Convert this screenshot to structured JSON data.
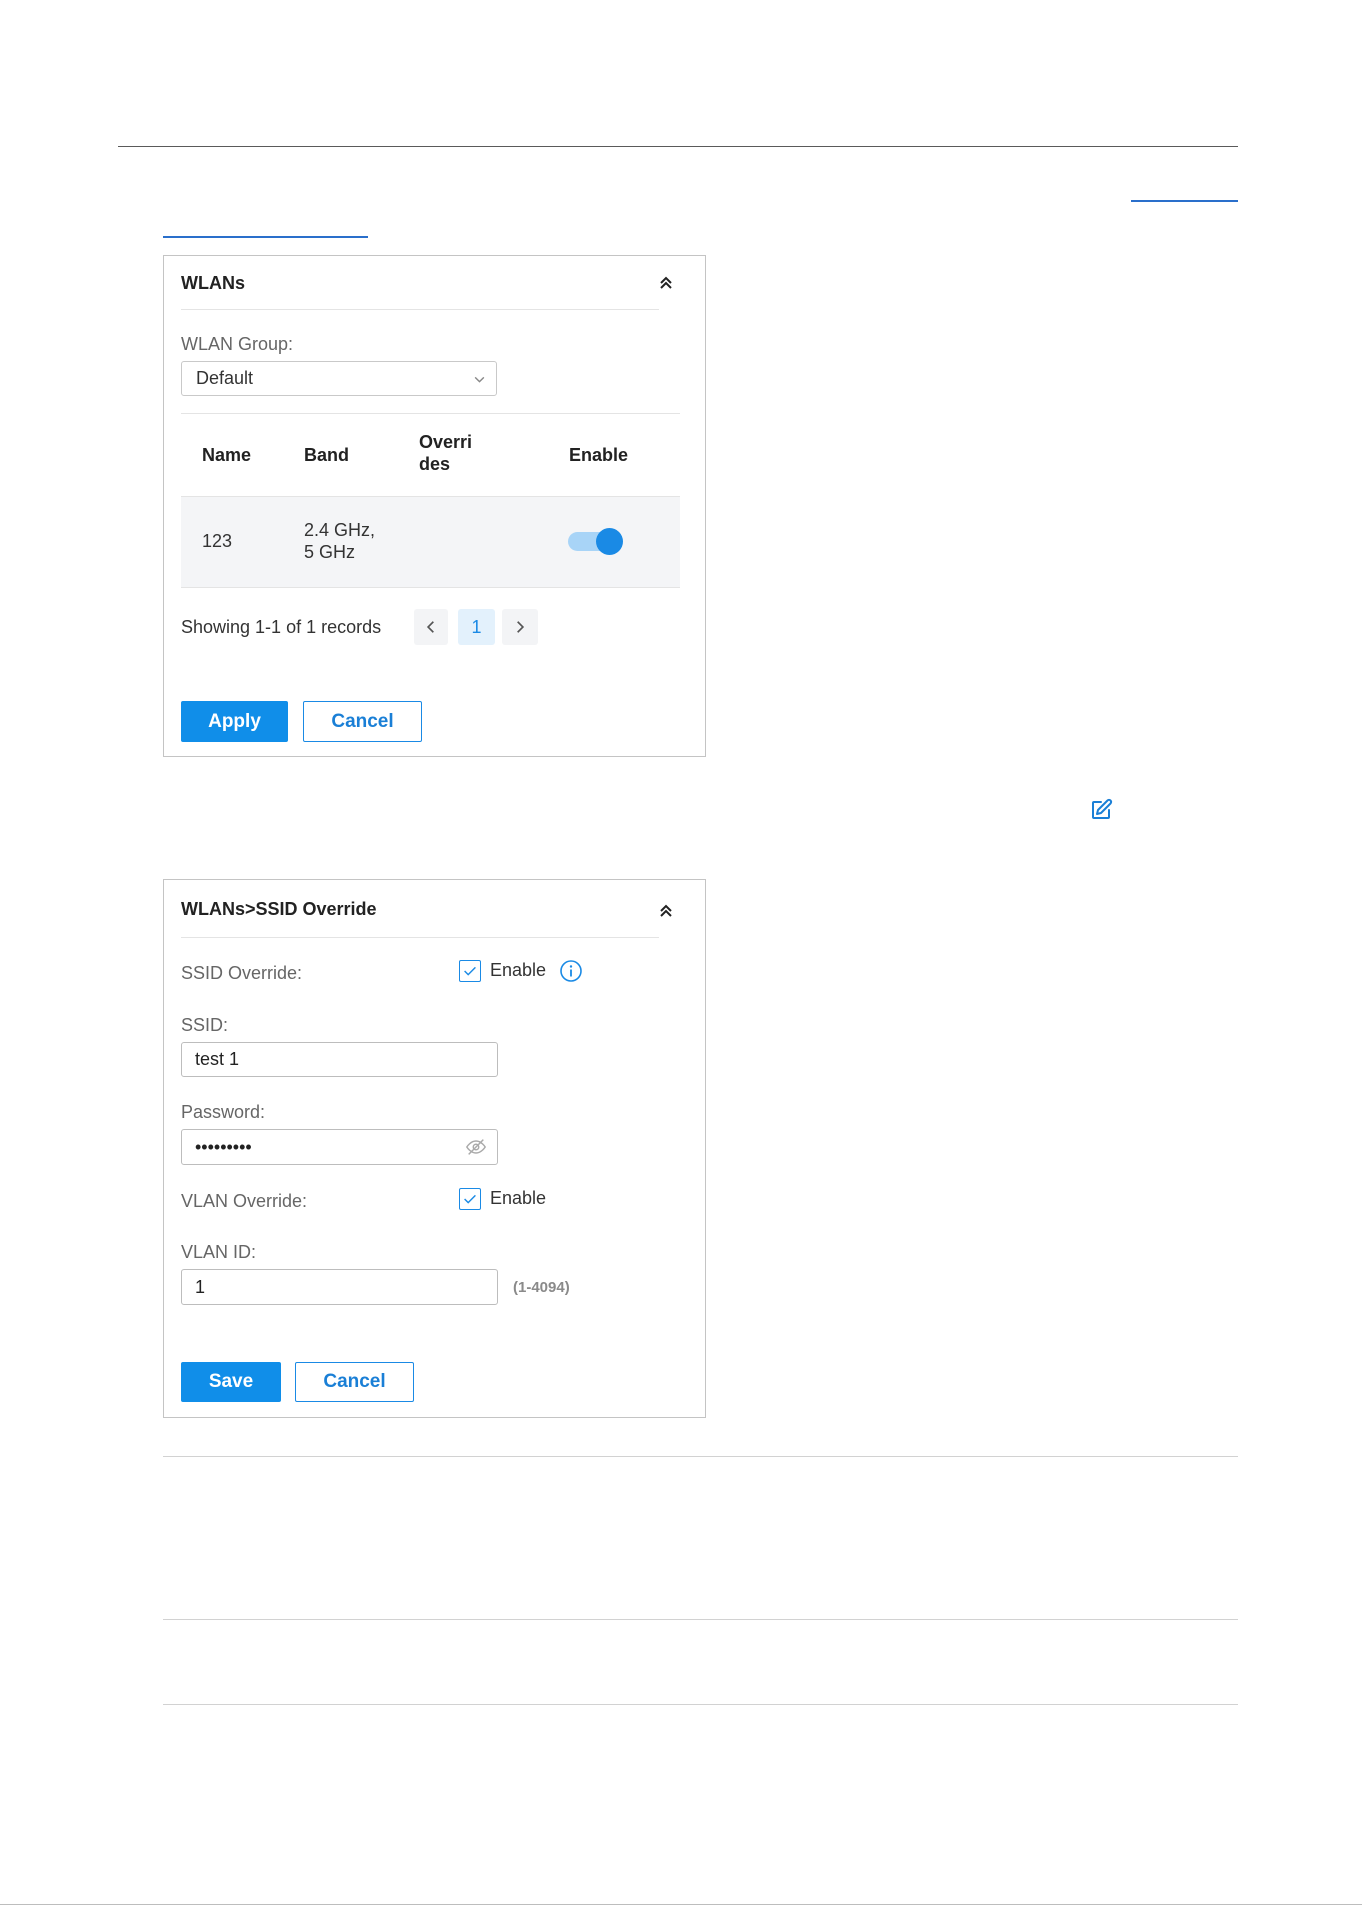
{
  "colors": {
    "accent": "#1a8ae5",
    "accent_text": "#1a7fd6",
    "button_bg": "#108ee9",
    "toggle_track": "#a8d4f7",
    "row_bg": "#f4f5f7",
    "page_active_bg": "#e3f1fc"
  },
  "icons": {
    "collapse": "double-chevron-up-icon",
    "select": "chevron-down-icon",
    "prev": "chevron-left-icon",
    "next": "chevron-right-icon",
    "edit": "edit-icon",
    "info": "info-icon",
    "check": "checkmark-icon",
    "password_toggle": "eye-slash-icon"
  },
  "wlans_panel": {
    "title": "WLANs",
    "group_label": "WLAN Group:",
    "group_value": "Default",
    "table": {
      "header_name": "Name",
      "header_band": "Band",
      "header_overrides_lines": [
        "Overri",
        "des"
      ],
      "header_enable": "Enable",
      "rows": [
        {
          "name": "123",
          "band_lines": [
            "2.4 GHz,",
            "5 GHz"
          ],
          "enabled": true
        }
      ]
    },
    "pagination": {
      "summary": "Showing 1-1 of 1 records",
      "current_page": "1"
    },
    "apply_label": "Apply",
    "cancel_label": "Cancel"
  },
  "ssid_panel": {
    "title": "WLANs>SSID Override",
    "ssid_override_label": "SSID Override:",
    "ssid_override_enabled": true,
    "ssid_override_enable_label": "Enable",
    "ssid_label": "SSID:",
    "ssid_value": "test 1",
    "password_label": "Password:",
    "password_value": "•••••••••",
    "vlan_override_label": "VLAN Override:",
    "vlan_override_enabled": true,
    "vlan_override_enable_label": "Enable",
    "vlan_id_label": "VLAN ID:",
    "vlan_id_value": "1",
    "vlan_id_range": "(1-4094)",
    "save_label": "Save",
    "cancel_label": "Cancel"
  }
}
